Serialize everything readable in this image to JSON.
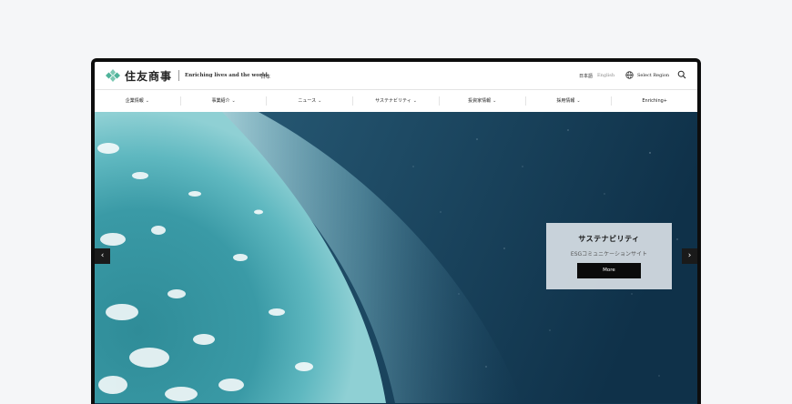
{
  "header": {
    "logo_text": "住友商事",
    "tagline": "Enriching lives and the world",
    "region_tag": "日本",
    "lang_ja": "日本語",
    "lang_en": "English",
    "select_region": "Select Region"
  },
  "nav": {
    "items": [
      {
        "label": "企業情報",
        "chevron": true
      },
      {
        "label": "事業紹介",
        "chevron": true
      },
      {
        "label": "ニュース",
        "chevron": true
      },
      {
        "label": "サステナビリティ",
        "chevron": true
      },
      {
        "label": "投資家情報",
        "chevron": true
      },
      {
        "label": "採用情報",
        "chevron": true
      },
      {
        "label": "Enriching+",
        "chevron": false
      }
    ]
  },
  "hero": {
    "prev_arrow": "‹",
    "next_arrow": "›",
    "card": {
      "title": "サステナビリティ",
      "subtitle": "ESGコミュニケーションサイト",
      "button_label": "More"
    }
  },
  "colors": {
    "logo_accent": "#4fb39a",
    "hero_space": "#113650",
    "card_bg": "#d6dee4",
    "button_bg": "#0b0b0b"
  }
}
